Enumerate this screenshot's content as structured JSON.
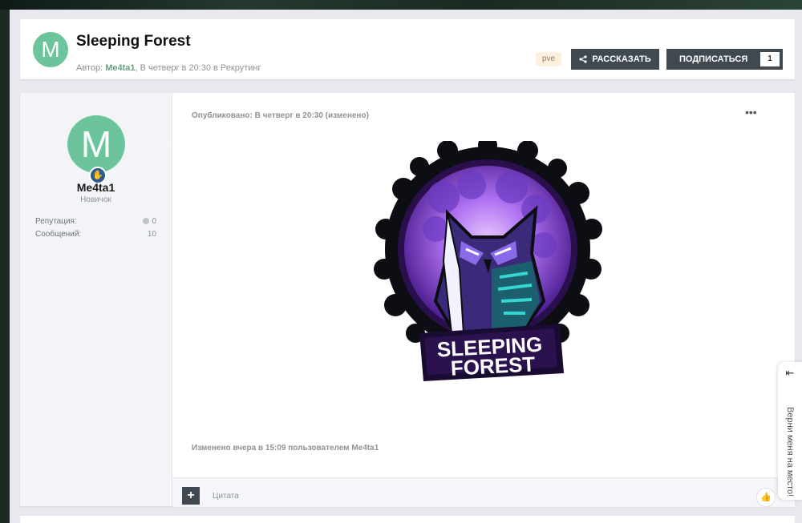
{
  "header": {
    "avatar_letter": "M",
    "title": "Sleeping Forest",
    "meta_prefix": "Автор: ",
    "author": "Me4ta1",
    "meta_suffix": ", В четверг в 20:30 в Рекрутинг",
    "tag": "pve",
    "share_label": "РАССКАЗАТЬ",
    "follow_label": "ПОДПИСАТЬСЯ",
    "follow_count": "1"
  },
  "author_panel": {
    "avatar_letter": "M",
    "username": "Me4ta1",
    "rank": "Новичок",
    "reputation_label": "Репутация:",
    "reputation_value": "0",
    "posts_label": "Сообщений:",
    "posts_value": "10"
  },
  "post": {
    "published": "Опубликовано: В четверг в 20:30 (изменено)",
    "logo_line1": "SLEEPING",
    "logo_line2": "FOREST",
    "edited": "Изменено вчера в 15:09 пользователем Me4ta1",
    "quote_label": "Цитата"
  },
  "side_widget": {
    "text": "Верни меня на место!"
  },
  "colors": {
    "accent_green": "#6bc49b",
    "dark_button": "#414950",
    "author_link": "#6aa27f"
  }
}
